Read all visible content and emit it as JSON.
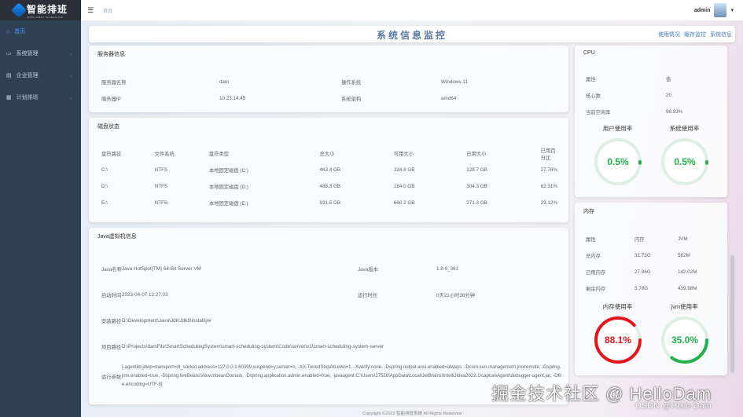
{
  "app": {
    "logo_title": "智能排班",
    "logo_sub": "INTELLIGENT SCHEDULING"
  },
  "sidebar": {
    "items": [
      {
        "label": "首页",
        "icon": "home-icon"
      },
      {
        "label": "系统管理",
        "icon": "monitor-icon"
      },
      {
        "label": "企业管理",
        "icon": "building-icon"
      },
      {
        "label": "计划排班",
        "icon": "calendar-icon"
      }
    ]
  },
  "header": {
    "breadcrumb": "首页",
    "user": "admin"
  },
  "titlebar": {
    "title": "系统信息监控",
    "links": [
      "使用情况",
      "缓存监控",
      "系统信息"
    ]
  },
  "server": {
    "title": "服务器信息",
    "rows": [
      [
        "服务器名称",
        "dam",
        "操作系统",
        "Windows 11"
      ],
      [
        "服务器IP",
        "10.23.14.45",
        "系统架构",
        "amd64"
      ]
    ]
  },
  "disk": {
    "title": "磁盘状态",
    "headers": [
      "盘符路径",
      "文件系统",
      "盘符类型",
      "总大小",
      "可用大小",
      "已用大小",
      "已用百分比"
    ],
    "rows": [
      [
        "C:\\",
        "NTFS",
        "本地固定磁盘 (C:)",
        "463.4 GB",
        "334.6 GB",
        "128.7 GB",
        "27.78%"
      ],
      [
        "D:\\",
        "NTFS",
        "本地固定磁盘 (D:)",
        "488.3 GB",
        "184.0 GB",
        "304.3 GB",
        "62.31%"
      ],
      [
        "E:\\",
        "NTFS",
        "本地固定磁盘 (E:)",
        "931.5 GB",
        "660.2 GB",
        "271.3 GB",
        "29.12%"
      ]
    ]
  },
  "jvm": {
    "title": "Java虚拟机信息",
    "name_label": "Java名称",
    "name": "Java HotSpot(TM) 64-Bit Server VM",
    "version_label": "Java版本",
    "version": "1.8.0_361",
    "start_label": "启动时间",
    "start": "2023-04-07 12:27:03",
    "uptime_label": "运行时长",
    "uptime": "0天21小时38分钟",
    "home_label": "安装路径",
    "home": "D:\\Development\\Java\\Jdk\\Jdk8\\install\\jre",
    "project_label": "项目路径",
    "project": "D:\\Projects\\damFile\\SmartSchedulingSystem\\smart-scheduling-system\\Code\\server\\v1\\smart-scheduling-system-server",
    "args_label": "运行参数",
    "args": "[-agentlib:jdwp=transport=dt_socket,address=127.0.0.1:60399,suspend=y,server=n, -XX:TieredStopAtLevel=1, -Xverify:none, -Dspring.output.ansi.enabled=always, -Dcom.sun.management.jmxremote, -Dspring.jmx.enabled=true, -Dspring.liveBeansView.mbeanDomain, -Dspring.application.admin.enabled=true, -javaagent:C:\\Users\\17526\\AppData\\Local\\JetBrains\\IntelliJIdea2022.1\\captureAgent\\debugger-agent.jar, -Dfile.encoding=UTF-8]"
  },
  "cpu": {
    "title": "CPU",
    "rows": [
      [
        "属性",
        "值"
      ],
      [
        "核心数",
        "20"
      ],
      [
        "当前空闲率",
        "98.93%"
      ]
    ],
    "gauges": [
      {
        "label": "用户使用率",
        "text": "0.5%",
        "value": 0.5,
        "color": "#22b14c"
      },
      {
        "label": "系统使用率",
        "text": "0.5%",
        "value": 0.5,
        "color": "#22b14c"
      }
    ]
  },
  "mem": {
    "title": "内存",
    "rows": [
      [
        "属性",
        "内存",
        "JVM"
      ],
      [
        "总内存",
        "31.73G",
        "582M"
      ],
      [
        "已用内存",
        "27.96G",
        "142.02M"
      ],
      [
        "剩余内存",
        "3.78G",
        "439.98M"
      ]
    ],
    "gauges": [
      {
        "label": "内存使用率",
        "text": "88.1%",
        "value": 88.1,
        "color": "#e8141c"
      },
      {
        "label": "jvm使用率",
        "text": "35.0%",
        "value": 35.0,
        "color": "#22b14c"
      }
    ]
  },
  "footer": "Copyright ©2023 智能排班系统 All Rights Reserved",
  "watermark": {
    "main": "掘金技术社区 @ HelloDam",
    "csdn": "CSDN @Hello Dam"
  }
}
